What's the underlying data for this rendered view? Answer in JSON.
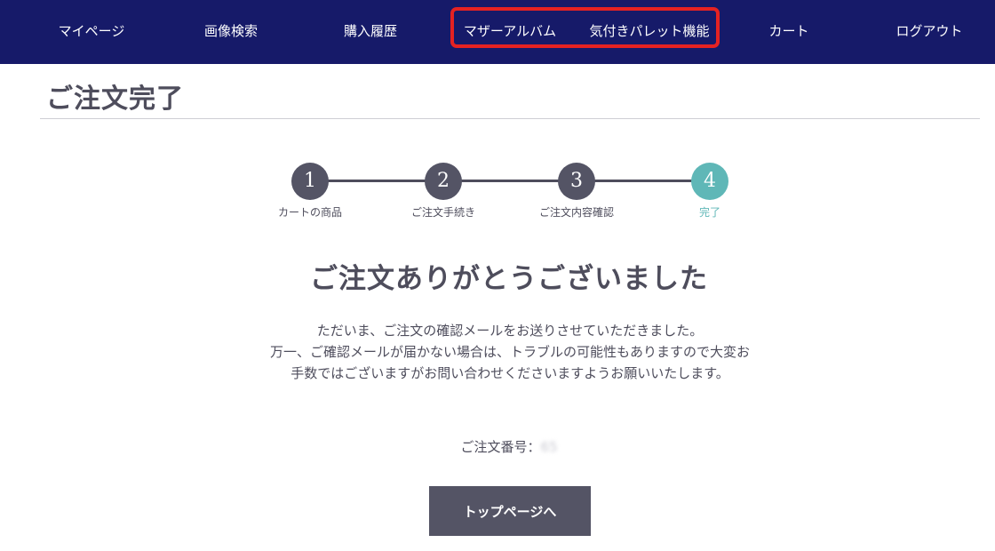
{
  "nav": {
    "items": [
      {
        "label": "マイページ"
      },
      {
        "label": "画像検索"
      },
      {
        "label": "購入履歴"
      },
      {
        "label": "マザーアルバム"
      },
      {
        "label": "気付きパレット機能"
      },
      {
        "label": "カート"
      },
      {
        "label": "ログアウト"
      }
    ],
    "highlight_color": "#e52222",
    "background_color": "#161a69"
  },
  "page_title": "ご注文完了",
  "stepper": {
    "steps": [
      {
        "number": "1",
        "label": "カートの商品"
      },
      {
        "number": "2",
        "label": "ご注文手続き"
      },
      {
        "number": "3",
        "label": "ご注文内容確認"
      },
      {
        "number": "4",
        "label": "完了"
      }
    ],
    "current_step": 4,
    "active_color": "#5fb7b7",
    "inactive_color": "#545465"
  },
  "thanks_heading": "ご注文ありがとうございました",
  "message_lines": [
    "ただいま、ご注文の確認メールをお送りさせていただきました。",
    "万一、ご確認メールが届かない場合は、トラブルの可能性もありますので大変お手数ではございますがお問い合わせくださいますようお願いいたします。"
  ],
  "order": {
    "label": "ご注文番号：",
    "value": "65"
  },
  "top_button": {
    "label": "トップページへ"
  }
}
